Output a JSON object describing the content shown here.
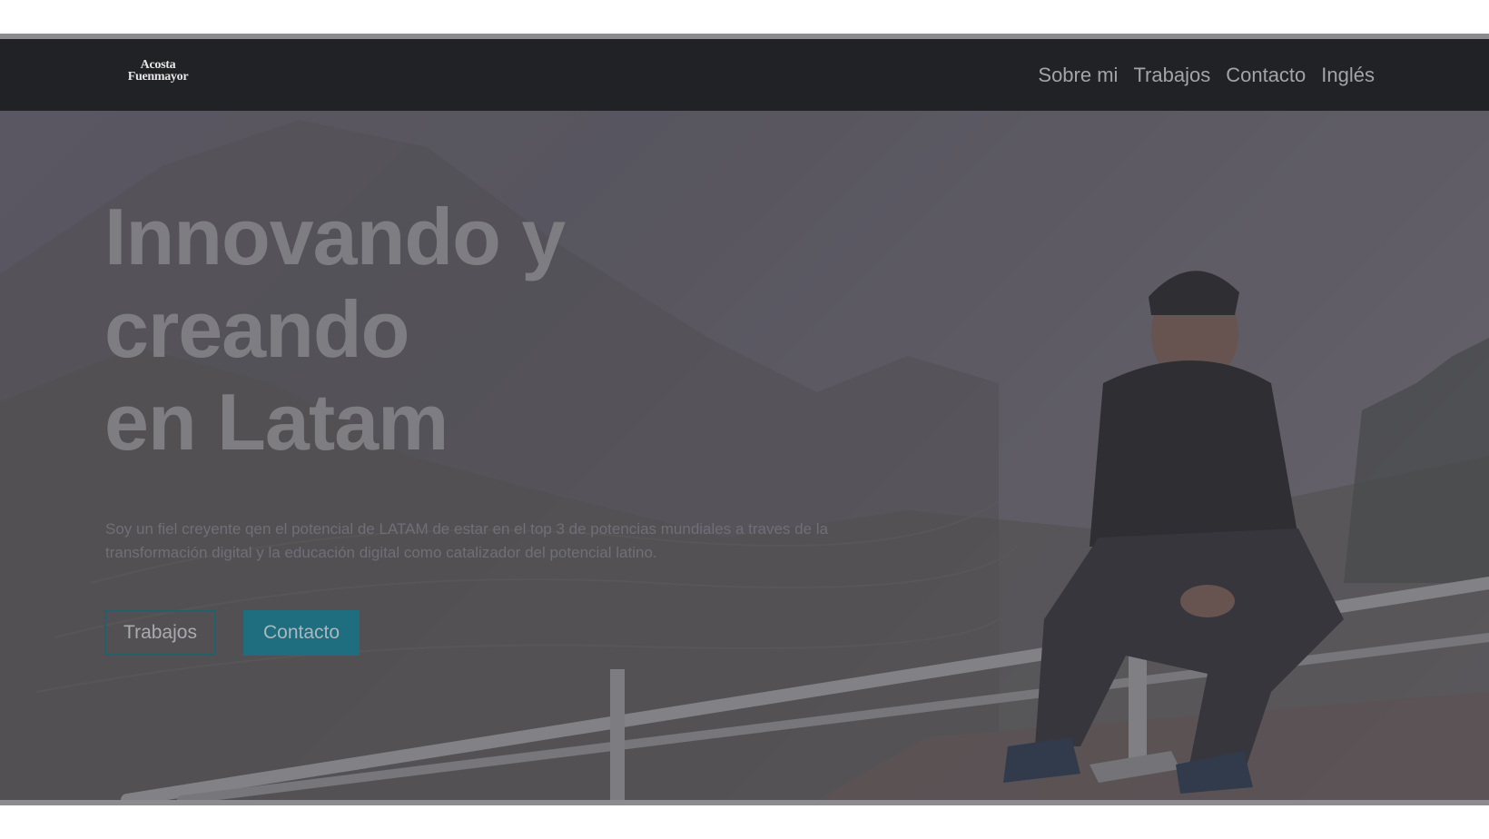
{
  "logo": {
    "line1": "Acosta",
    "line2": "Fuenmayor"
  },
  "nav": {
    "items": [
      {
        "label": "Sobre mi"
      },
      {
        "label": "Trabajos"
      },
      {
        "label": "Contacto"
      },
      {
        "label": "Inglés"
      }
    ]
  },
  "hero": {
    "title_lines": [
      "Innovando y",
      "creando",
      "en Latam"
    ],
    "description": "Soy un fiel creyente qen el potencial de LATAM de estar en el top 3 de potencias mundiales a traves de la transformación digital y la educación digital como catalizador del potencial latino.",
    "buttons": {
      "primary_outline": "Trabajos",
      "primary_fill": "Contacto"
    }
  },
  "colors": {
    "navbar": "#212226",
    "accent": "#1e6e80",
    "page_background": "#ffffff"
  }
}
